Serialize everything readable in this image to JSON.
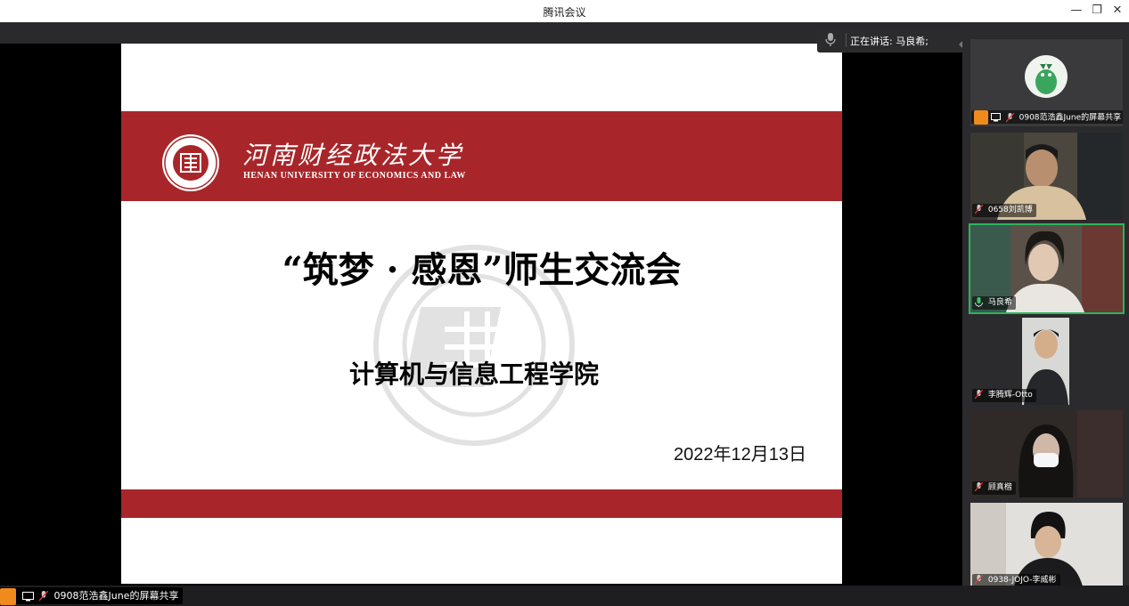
{
  "window": {
    "title": "腾讯会议",
    "min_glyph": "—",
    "max_glyph": "❐",
    "close_glyph": "✕"
  },
  "slide": {
    "university_cn": "河南财经政法大学",
    "university_en": "HENAN UNIVERSITY OF ECONOMICS AND LAW",
    "title": "“筑梦 · 感恩”师生交流会",
    "subtitle": "计算机与信息工程学院",
    "date": "2022年12月13日",
    "accent_color": "#a8262a"
  },
  "speaking": {
    "text": "正在讲话: 马良希;"
  },
  "participants": [
    {
      "name": "0908范浩鑫June的屏幕共享",
      "type": "avatar",
      "icon": "person-icon"
    },
    {
      "name": "0658刘凯博",
      "type": "video"
    },
    {
      "name": "马良希",
      "type": "video",
      "active": true
    },
    {
      "name": "李腾辉-Otto",
      "type": "video"
    },
    {
      "name": "顾真楷",
      "type": "video"
    },
    {
      "name": "0938-JOJO-李威彬",
      "type": "video"
    }
  ],
  "bottom": {
    "share_label": "0908范浩鑫June的屏幕共享"
  }
}
